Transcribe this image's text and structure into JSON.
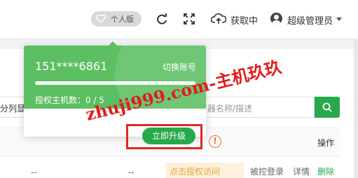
{
  "header": {
    "version_label": "个人版",
    "status_label": "获取中",
    "user_name": "超级管理员"
  },
  "popover": {
    "phone": "151****6861",
    "switch_label": "切换账号",
    "authorized_hosts_label": "授权主机数：0 / 5",
    "authorized_hosts_used": 0,
    "authorized_hosts_total": 5,
    "upgrade_label": "立即升级"
  },
  "content": {
    "filter_label": "分列显示",
    "search_placeholder": "器名称/描述",
    "operation_header": "操作",
    "row": {
      "dash_a": "--",
      "dash_b": "--",
      "auth_tag": "点击授权访问",
      "remote_login": "被控登录",
      "details": "详情",
      "delete": "删除"
    }
  },
  "watermark": "zhuji999.com-主机玖玖",
  "colors": {
    "accent_green": "#27a94b",
    "popover_green": "#5cbf62",
    "warning_orange": "#f56c2a",
    "highlight_red": "#e32626"
  },
  "icons": [
    "diamond-icon",
    "refresh-icon",
    "fullscreen-icon",
    "cloud-upload-icon",
    "user-avatar-icon",
    "caret-down-icon",
    "search-icon",
    "warning-icon"
  ]
}
